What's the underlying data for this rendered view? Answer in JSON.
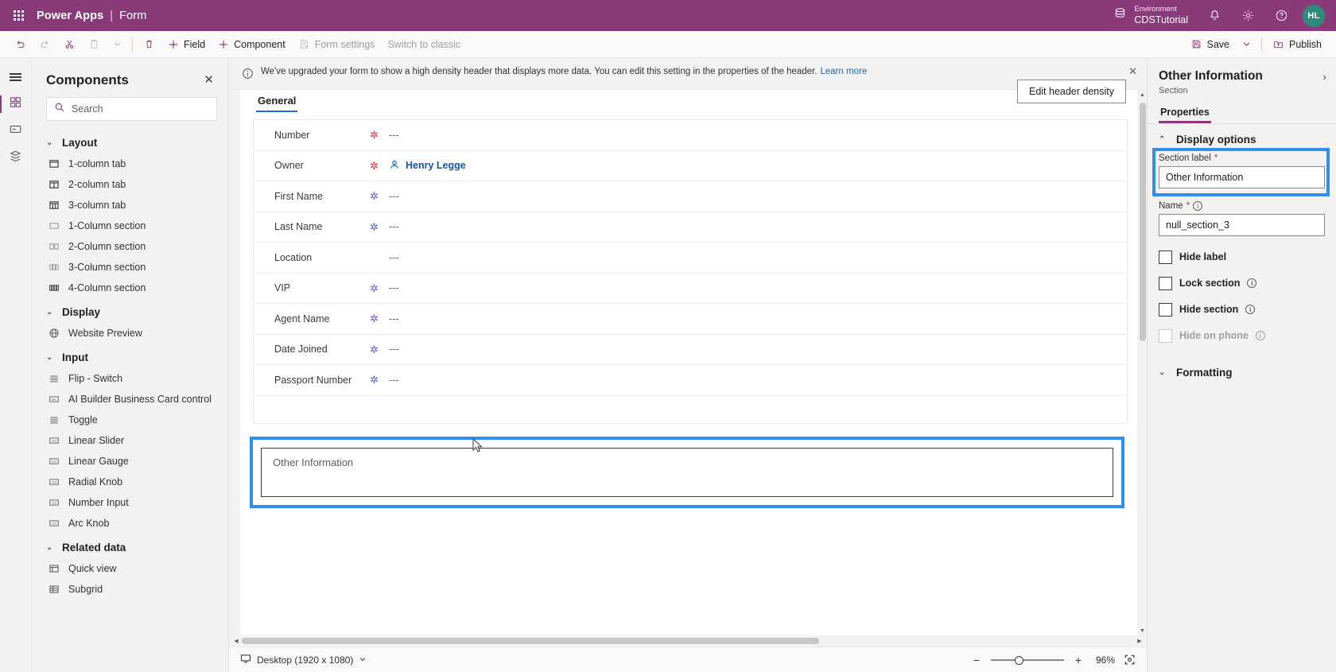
{
  "header": {
    "waffle_icon": "waffle-icon",
    "brand": "Power Apps",
    "separator": "|",
    "doc_type": "Form",
    "environment_label": "Environment",
    "environment_name": "CDSTutorial",
    "env_icon": "environment-icon",
    "notification_icon": "bell-icon",
    "settings_icon": "gear-icon",
    "help_icon": "help-icon",
    "avatar_initials": "HL"
  },
  "commandbar": {
    "undo": "",
    "redo": "",
    "cut": "",
    "copy": "",
    "more": "",
    "delete": "",
    "field": "Field",
    "component": "Component",
    "form_settings": "Form settings",
    "switch_to_classic": "Switch to classic",
    "save": "Save",
    "save_caret": "",
    "publish": "Publish"
  },
  "rail": {
    "menu_icon": "hamburger-icon",
    "items": [
      {
        "name": "components",
        "icon": "components-icon"
      },
      {
        "name": "fields",
        "icon": "fields-icon"
      },
      {
        "name": "data",
        "icon": "data-icon"
      }
    ]
  },
  "components_panel": {
    "title": "Components",
    "close_icon": "close-icon",
    "search": {
      "placeholder": "Search",
      "value": ""
    },
    "groups": [
      {
        "label": "Layout",
        "items": [
          {
            "label": "1-column tab",
            "icon": "one-column-tab-icon"
          },
          {
            "label": "2-column tab",
            "icon": "two-column-tab-icon"
          },
          {
            "label": "3-column tab",
            "icon": "three-column-tab-icon"
          },
          {
            "label": "1-Column section",
            "icon": "one-column-section-icon"
          },
          {
            "label": "2-Column section",
            "icon": "two-column-section-icon"
          },
          {
            "label": "3-Column section",
            "icon": "three-column-section-icon"
          },
          {
            "label": "4-Column section",
            "icon": "four-column-section-icon"
          }
        ]
      },
      {
        "label": "Display",
        "items": [
          {
            "label": "Website Preview",
            "icon": "globe-icon"
          }
        ]
      },
      {
        "label": "Input",
        "items": [
          {
            "label": "Flip - Switch",
            "icon": "list-icon"
          },
          {
            "label": "AI Builder Business Card control",
            "icon": "abc-icon"
          },
          {
            "label": "Toggle",
            "icon": "list-icon"
          },
          {
            "label": "Linear Slider",
            "icon": "number-icon"
          },
          {
            "label": "Linear Gauge",
            "icon": "number-icon"
          },
          {
            "label": "Radial Knob",
            "icon": "number-icon"
          },
          {
            "label": "Number Input",
            "icon": "number-icon"
          },
          {
            "label": "Arc Knob",
            "icon": "number-icon"
          }
        ]
      },
      {
        "label": "Related data",
        "items": [
          {
            "label": "Quick view",
            "icon": "quick-view-icon"
          },
          {
            "label": "Subgrid",
            "icon": "subgrid-icon"
          }
        ]
      }
    ]
  },
  "notice": {
    "info_icon": "info-icon",
    "text": "We've upgraded your form to show a high density header that displays more data. You can edit this setting in the properties of the header.",
    "link": "Learn more",
    "close_icon": "close-icon",
    "button": "Edit header density"
  },
  "form": {
    "tab": "General",
    "rows": [
      {
        "label": "Number",
        "required": "red",
        "value": "---",
        "type": "text"
      },
      {
        "label": "Owner",
        "required": "red",
        "value": "Henry Legge",
        "type": "person",
        "icon": "person-icon"
      },
      {
        "label": "First Name",
        "required": "blue",
        "value": "---",
        "type": "text"
      },
      {
        "label": "Last Name",
        "required": "blue",
        "value": "---",
        "type": "text"
      },
      {
        "label": "Location",
        "required": "none",
        "value": "---",
        "type": "text"
      },
      {
        "label": "VIP",
        "required": "blue",
        "value": "---",
        "type": "text"
      },
      {
        "label": "Agent Name",
        "required": "blue",
        "value": "---",
        "type": "text"
      },
      {
        "label": "Date Joined",
        "required": "blue",
        "value": "---",
        "type": "text"
      },
      {
        "label": "Passport Number",
        "required": "blue",
        "value": "---",
        "type": "text"
      }
    ],
    "selected_section_label": "Other Information"
  },
  "statusbar": {
    "screen_icon": "monitor-icon",
    "screen_size": "Desktop (1920 x 1080)",
    "screen_caret": "chevron-down-icon",
    "zoom_out": "−",
    "zoom_in": "+",
    "zoom_percent": "96%",
    "fit_icon": "fit-to-screen-icon"
  },
  "properties": {
    "title": "Other Information",
    "subtitle": "Section",
    "expand_icon": "chevron-right-icon",
    "tab": "Properties",
    "display_options": "Display options",
    "section_label": {
      "label": "Section label",
      "required": "*",
      "value": "Other Information"
    },
    "name": {
      "label": "Name",
      "required": "*",
      "value": "null_section_3",
      "info_icon": "info-icon"
    },
    "checkboxes": [
      {
        "label": "Hide label",
        "checked": false,
        "disabled": false,
        "info": false
      },
      {
        "label": "Lock section",
        "checked": false,
        "disabled": false,
        "info": true
      },
      {
        "label": "Hide section",
        "checked": false,
        "disabled": false,
        "info": true
      },
      {
        "label": "Hide on phone",
        "checked": false,
        "disabled": true,
        "info": true
      }
    ],
    "formatting": "Formatting"
  },
  "colors": {
    "brand_purple": "#8a3a79",
    "highlight_blue": "#2f8ff0",
    "link_blue": "#0f6cbd",
    "required_red": "#d13438",
    "optional_blue": "#5b5fc7",
    "tab_underline": "#2266dd"
  }
}
